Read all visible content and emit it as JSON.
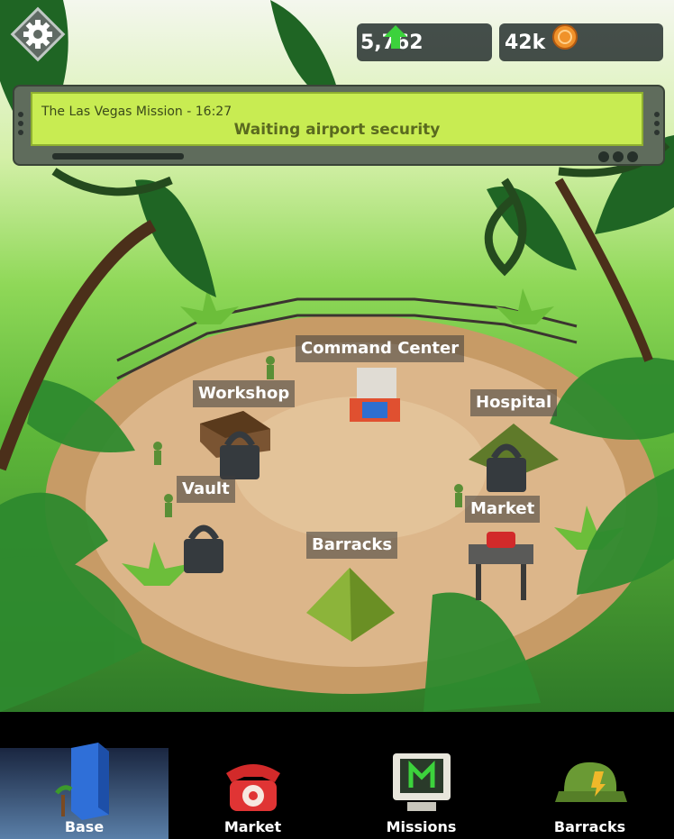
{
  "hud": {
    "settings_icon": "gear-icon",
    "upgrades": {
      "icon": "green-up-arrow-icon",
      "value": "5,762"
    },
    "coins": {
      "icon": "coin-icon",
      "value": "42k"
    }
  },
  "mission": {
    "title": "The Las Vegas Mission - 16:27",
    "status": "Waiting airport security"
  },
  "buildings": {
    "command_center": "Command Center",
    "workshop": "Workshop",
    "hospital": "Hospital",
    "vault": "Vault",
    "market": "Market",
    "barracks": "Barracks"
  },
  "nav": {
    "tabs": [
      {
        "label": "Base",
        "icon": "building-icon",
        "active": true
      },
      {
        "label": "Market",
        "icon": "telephone-icon",
        "active": false
      },
      {
        "label": "Missions",
        "icon": "computer-icon",
        "active": false
      },
      {
        "label": "Barracks",
        "icon": "army-cap-icon",
        "active": false
      }
    ]
  },
  "colors": {
    "mission_screen": "#c8ec52",
    "nav_active": "#5a7fa8",
    "upgrade_arrow": "#3cd23c",
    "coin": "#f0922a"
  }
}
